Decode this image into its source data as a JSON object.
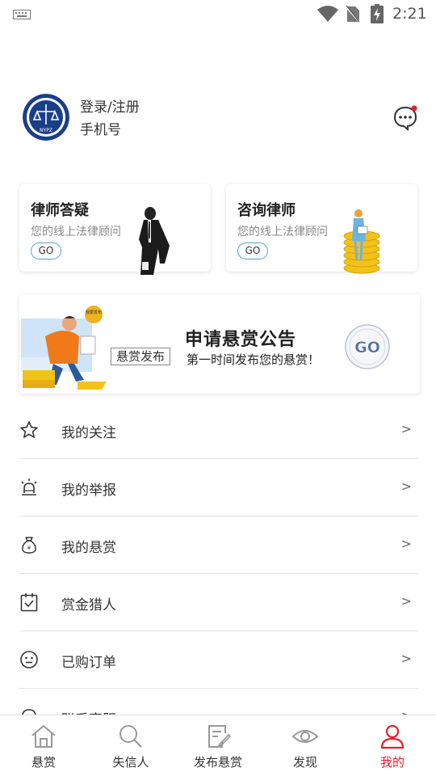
{
  "status_bar": {
    "time": "2:21"
  },
  "profile": {
    "login_label": "登录/注册",
    "phone_label": "手机号",
    "avatar_text": "NYPZ",
    "unread_dot_color": "#e5212b"
  },
  "cards": [
    {
      "title": "律师答疑",
      "subtitle": "您的线上法律顾问",
      "button": "GO"
    },
    {
      "title": "咨询律师",
      "subtitle": "您的线上法律顾问",
      "button": "GO"
    }
  ],
  "banner": {
    "badge": "我要发布",
    "tag": "悬赏发布",
    "title": "申请悬赏公告",
    "subtitle": "第一时间发布您的悬赏！",
    "go": "GO"
  },
  "menu": [
    {
      "label": "我的关注",
      "icon": "star-icon",
      "arrow": ">"
    },
    {
      "label": "我的举报",
      "icon": "alarm-icon",
      "arrow": ">"
    },
    {
      "label": "我的悬赏",
      "icon": "money-bag-icon",
      "arrow": ">"
    },
    {
      "label": "赏金猎人",
      "icon": "clipboard-check-icon",
      "arrow": ">"
    },
    {
      "label": "已购订单",
      "icon": "smiley-icon",
      "arrow": ">"
    },
    {
      "label": "联系客服",
      "icon": "headset-icon",
      "arrow": ">"
    }
  ],
  "bottom_nav": [
    {
      "label": "悬赏",
      "icon": "home-icon"
    },
    {
      "label": "失信人",
      "icon": "search-icon"
    },
    {
      "label": "发布悬赏",
      "icon": "edit-icon"
    },
    {
      "label": "发现",
      "icon": "eye-icon"
    },
    {
      "label": "我的",
      "icon": "user-icon",
      "active": true
    }
  ],
  "colors": {
    "accent_red": "#e5212b",
    "go_border": "#4aa3df",
    "text": "#333333"
  }
}
